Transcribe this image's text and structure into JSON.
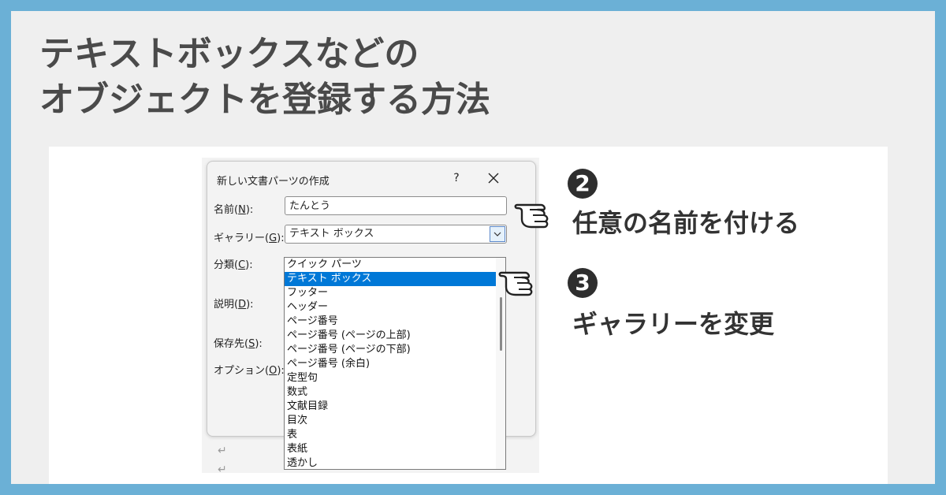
{
  "title": {
    "line1": "テキストボックスなどの",
    "line2": "オブジェクトを登録する方法"
  },
  "dialog": {
    "title": "新しい文書パーツの作成",
    "help_label": "?",
    "labels": {
      "name": "名前",
      "name_key": "N",
      "gallery": "ギャラリー",
      "gallery_key": "G",
      "category": "分類",
      "category_key": "C",
      "description": "説明",
      "description_key": "D",
      "save_in": "保存先",
      "save_in_key": "S",
      "options": "オプション",
      "options_key": "O"
    },
    "name_value": "たんとう",
    "gallery_value": "テキスト ボックス",
    "gallery_options": [
      "クイック パーツ",
      "テキスト ボックス",
      "フッター",
      "ヘッダー",
      "ページ番号",
      "ページ番号 (ページの上部)",
      "ページ番号 (ページの下部)",
      "ページ番号 (余白)",
      "定型句",
      "数式",
      "文献目録",
      "目次",
      "表",
      "表紙",
      "透かし"
    ],
    "selected_index": 1
  },
  "annotations": {
    "step2_num": "2",
    "step2_text": "任意の名前を付ける",
    "step3_num": "3",
    "step3_text": "ギャラリーを変更"
  },
  "colors": {
    "frame": "#6bb0d6",
    "background": "#efefef",
    "selection": "#0078d7",
    "step_circle": "#2e2e2e"
  },
  "icons": [
    "close-icon",
    "chevron-down-icon",
    "pointing-hand-icon",
    "return-arrow-icon"
  ]
}
